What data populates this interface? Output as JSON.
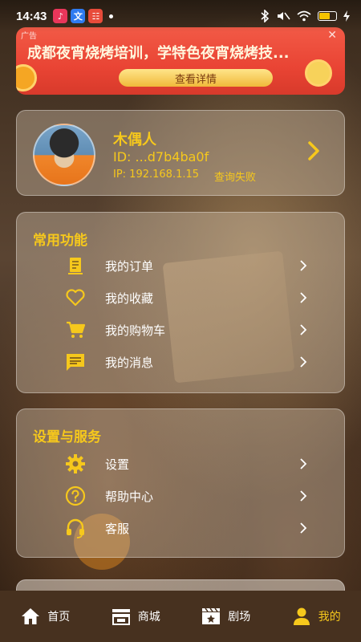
{
  "status_bar": {
    "time": "14:43",
    "notifications": [
      {
        "icon": "music-app-icon",
        "color": "#e9365a",
        "glyph": "♪"
      },
      {
        "icon": "translate-app-icon",
        "color": "#2f7bf0",
        "glyph": "文"
      },
      {
        "icon": "shopping-app-icon",
        "color": "#e84b3a",
        "glyph": "☷"
      }
    ],
    "system_icons": [
      "bluetooth-icon",
      "mute-icon",
      "wifi-icon",
      "battery-icon",
      "charging-icon"
    ]
  },
  "ad": {
    "tag": "广告",
    "title": "成都夜宵烧烤培训，学特色夜宵烧烤技...",
    "button_label": "查看详情"
  },
  "profile": {
    "name": "木偶人",
    "id_text": "ID: ...d7b4ba0f",
    "ip_text": "IP: 192.168.1.15",
    "ip_status": "查询失败"
  },
  "common_functions": {
    "title": "常用功能",
    "items": [
      {
        "label": "我的订单",
        "icon": "order-icon"
      },
      {
        "label": "我的收藏",
        "icon": "heart-icon"
      },
      {
        "label": "我的购物车",
        "icon": "cart-icon"
      },
      {
        "label": "我的消息",
        "icon": "message-icon"
      }
    ]
  },
  "settings_services": {
    "title": "设置与服务",
    "items": [
      {
        "label": "设置",
        "icon": "gear-icon"
      },
      {
        "label": "帮助中心",
        "icon": "help-icon"
      },
      {
        "label": "客服",
        "icon": "headset-icon"
      }
    ]
  },
  "tabs": [
    {
      "label": "首页",
      "icon": "home-icon",
      "active": false
    },
    {
      "label": "商城",
      "icon": "store-icon",
      "active": false
    },
    {
      "label": "剧场",
      "icon": "theater-icon",
      "active": false
    },
    {
      "label": "我的",
      "icon": "user-icon",
      "active": true
    }
  ],
  "colors": {
    "accent": "#f6c81c",
    "tab_bar": "#47311f",
    "ad_background": "#e94434"
  }
}
